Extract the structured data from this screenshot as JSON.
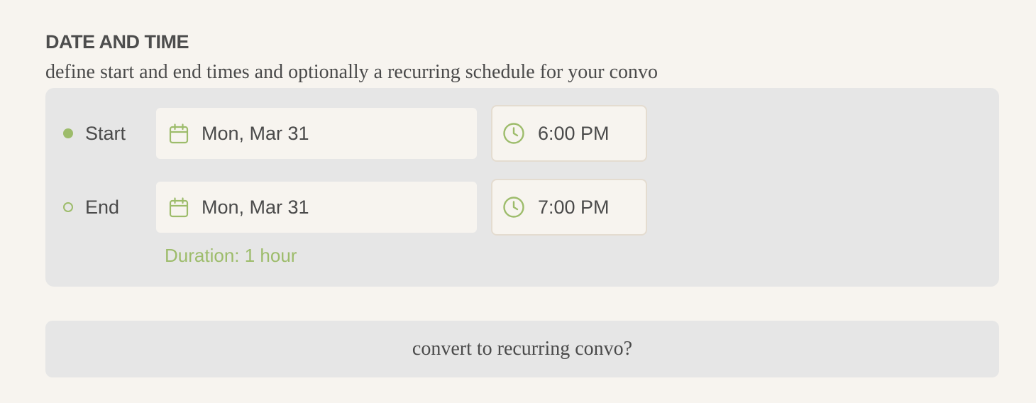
{
  "section": {
    "title": "DATE AND TIME",
    "subtitle": "define start and end times and optionally a recurring schedule for your convo"
  },
  "schedule": {
    "start": {
      "label": "Start",
      "date": "Mon, Mar 31",
      "time": "6:00 PM",
      "indicator": "filled-dot"
    },
    "end": {
      "label": "End",
      "date": "Mon, Mar 31",
      "time": "7:00 PM",
      "indicator": "hollow-dot"
    },
    "duration": "Duration: 1 hour"
  },
  "icons": {
    "date": "calendar-icon",
    "time": "clock-icon"
  },
  "actions": {
    "convert_label": "convert to recurring convo?"
  },
  "colors": {
    "accent": "#9dbc6b",
    "background": "#f7f4ef",
    "panel": "#e6e6e6",
    "text": "#4a4a4a"
  }
}
